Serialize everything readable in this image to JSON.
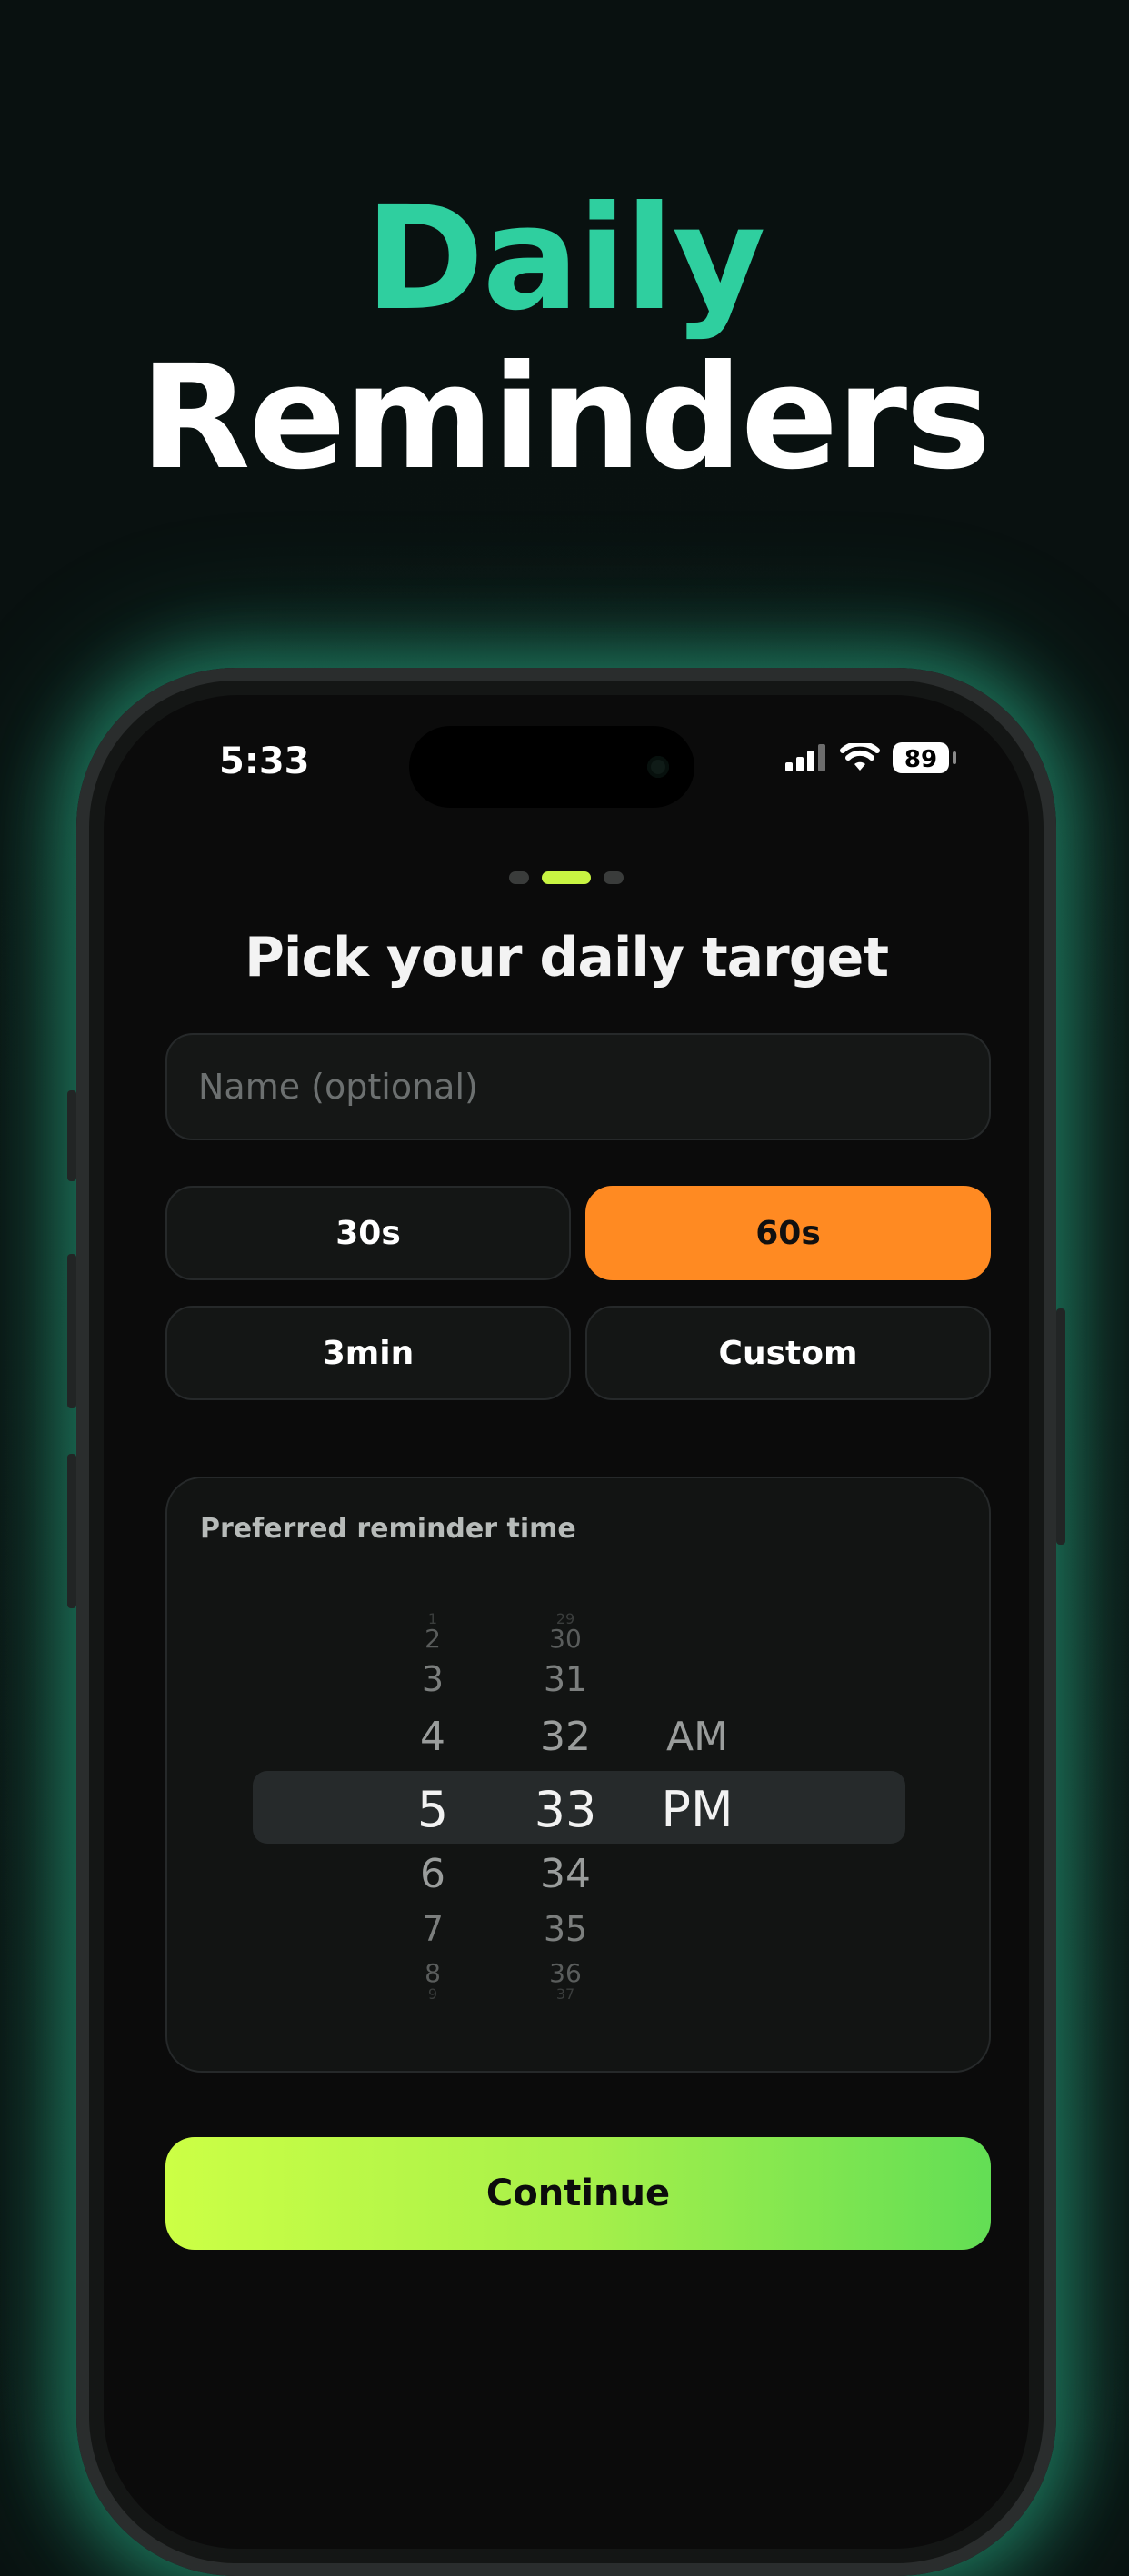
{
  "headline": {
    "line1": "Daily",
    "line2": "Reminders"
  },
  "status_bar": {
    "time": "5:33",
    "battery": "89"
  },
  "pager": {
    "count": 3,
    "active_index": 1
  },
  "screen": {
    "title": "Pick your daily target",
    "name_field": {
      "placeholder": "Name (optional)",
      "value": ""
    },
    "targets": [
      {
        "label": "30s",
        "selected": false
      },
      {
        "label": "60s",
        "selected": true
      },
      {
        "label": "3min",
        "selected": false
      },
      {
        "label": "Custom",
        "selected": false
      }
    ],
    "reminder": {
      "label": "Preferred reminder time",
      "hours": [
        "1",
        "2",
        "3",
        "4",
        "5",
        "6",
        "7",
        "8",
        "9"
      ],
      "minutes": [
        "29",
        "30",
        "31",
        "32",
        "33",
        "34",
        "35",
        "36",
        "37"
      ],
      "period": [
        "AM",
        "PM"
      ],
      "selected": {
        "hour": "5",
        "minute": "33",
        "period": "PM"
      }
    },
    "continue_label": "Continue"
  },
  "colors": {
    "accent_green": "#2fcf9f",
    "selected_orange": "#ff8a22",
    "pager_active": "#c8f542",
    "cta_gradient_start": "#ccff45",
    "cta_gradient_end": "#63de55"
  }
}
